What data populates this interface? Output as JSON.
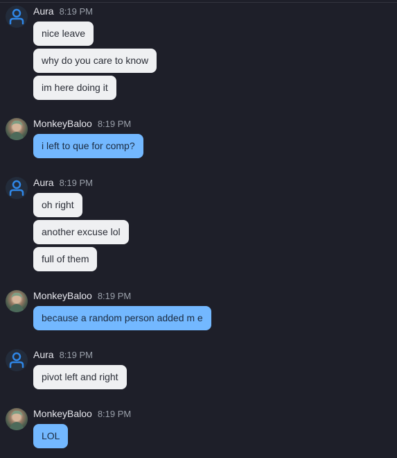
{
  "colors": {
    "background": "#1e1f29",
    "incoming_bubble": "#eff0f2",
    "outgoing_bubble": "#73b8ff",
    "avatar_icon": "#2f87e8"
  },
  "messages": [
    {
      "sender": "Aura",
      "time": "8:19 PM",
      "avatar": "default-user-icon",
      "lines": [
        "nice leave",
        "why do you care to know",
        "im here doing it"
      ]
    },
    {
      "sender": "MonkeyBaloo",
      "time": "8:19 PM",
      "avatar": "profile-photo",
      "lines": [
        "i left to que for comp?"
      ]
    },
    {
      "sender": "Aura",
      "time": "8:19 PM",
      "avatar": "default-user-icon",
      "lines": [
        "oh right",
        "another excuse lol",
        "full of them"
      ]
    },
    {
      "sender": "MonkeyBaloo",
      "time": "8:19 PM",
      "avatar": "profile-photo",
      "lines": [
        "because a random person added m e"
      ]
    },
    {
      "sender": "Aura",
      "time": "8:19 PM",
      "avatar": "default-user-icon",
      "lines": [
        "pivot left and right"
      ]
    },
    {
      "sender": "MonkeyBaloo",
      "time": "8:19 PM",
      "avatar": "profile-photo",
      "lines": [
        "LOL"
      ]
    }
  ]
}
